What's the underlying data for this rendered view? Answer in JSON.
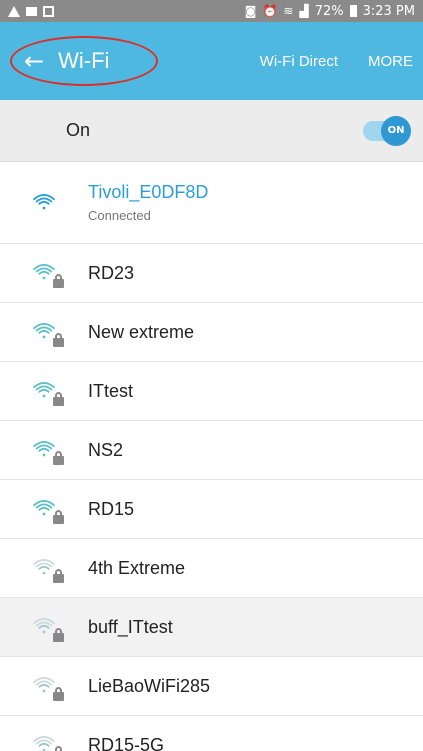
{
  "status_bar": {
    "battery": "72%",
    "time": "3:23 PM"
  },
  "action_bar": {
    "title": "Wi-Fi",
    "wifi_direct": "Wi-Fi Direct",
    "more": "MORE"
  },
  "toggle_row": {
    "label": "On",
    "toggle_text": "ON"
  },
  "colors": {
    "action_bar": "#4fb8e0",
    "accent": "#2a9fd3",
    "highlight_circle": "#d9302a"
  },
  "networks": [
    {
      "name": "Tivoli_E0DF8D",
      "status": "Connected",
      "locked": false,
      "signal_strength": 3
    },
    {
      "name": "RD23",
      "locked": true,
      "signal_strength": 3
    },
    {
      "name": "New extreme",
      "locked": true,
      "signal_strength": 3
    },
    {
      "name": "ITtest",
      "locked": true,
      "signal_strength": 3
    },
    {
      "name": "NS2",
      "locked": true,
      "signal_strength": 3
    },
    {
      "name": "RD15",
      "locked": true,
      "signal_strength": 3
    },
    {
      "name": "4th Extreme",
      "locked": true,
      "signal_strength": 2
    },
    {
      "name": "buff_ITtest",
      "locked": true,
      "signal_strength": 2
    },
    {
      "name": "LieBaoWiFi285",
      "locked": true,
      "signal_strength": 2
    },
    {
      "name": "RD15-5G",
      "locked": true,
      "signal_strength": 2
    }
  ]
}
